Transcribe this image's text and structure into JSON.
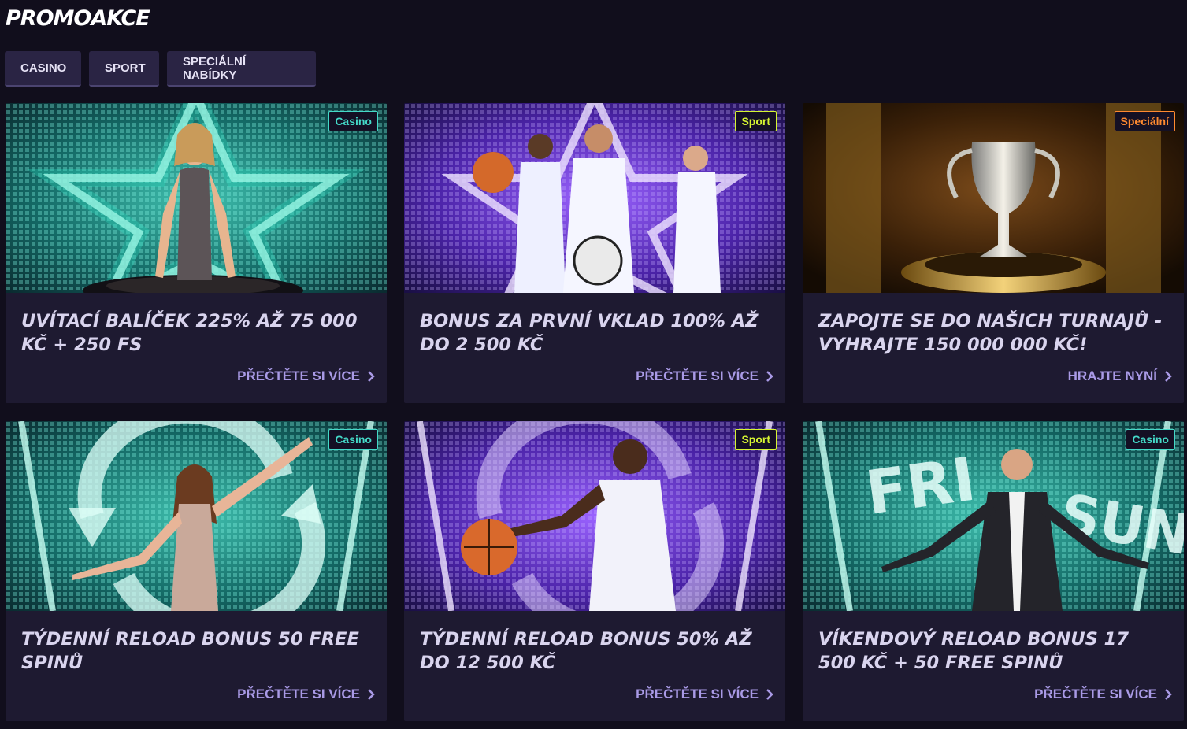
{
  "page": {
    "title": "PROMOAKCE"
  },
  "tabs": [
    {
      "label": "CASINO"
    },
    {
      "label": "SPORT"
    },
    {
      "label": "SPECIÁLNÍ NABÍDKY"
    }
  ],
  "colors": {
    "casino_badge": "#44d9c8",
    "sport_badge": "#d6f532",
    "special_badge": "#ff8a30",
    "link": "#a99ae6",
    "card_bg": "#1e1a31",
    "page_bg": "#110e1c"
  },
  "cards": [
    {
      "badge": "Casino",
      "title": "UVÍTACÍ BALÍČEK 225% AŽ 75 000 KČ + 250 FS",
      "link": "PŘEČTĚTE SI VÍCE",
      "image": "casino-hostess-roulette-image"
    },
    {
      "badge": "Sport",
      "title": "BONUS ZA PRVNÍ VKLAD 100% AŽ DO 2 500 KČ",
      "link": "PŘEČTĚTE SI VÍCE",
      "image": "three-athletes-image"
    },
    {
      "badge": "Speciální",
      "title": "ZAPOJTE SE DO NAŠICH TURNAJŮ - VYHRAJTE 150 000 000 KČ!",
      "link": "HRAJTE NYNÍ",
      "image": "trophy-image"
    },
    {
      "badge": "Casino",
      "title": "TÝDENNÍ RELOAD BONUS 50 FREE SPINŮ",
      "link": "PŘEČTĚTE SI VÍCE",
      "image": "woman-reload-arrows-image"
    },
    {
      "badge": "Sport",
      "title": "TÝDENNÍ RELOAD BONUS 50% AŽ DO 12 500 KČ",
      "link": "PŘEČTĚTE SI VÍCE",
      "image": "basketball-player-image"
    },
    {
      "badge": "Casino",
      "title": "VÍKENDOVÝ RELOAD BONUS 17 500 KČ + 50 FREE SPINŮ",
      "link": "PŘEČTĚTE SI VÍCE",
      "image": "man-fri-sun-image"
    }
  ],
  "image_text": {
    "fri": "FRI",
    "sun": "SUN"
  }
}
